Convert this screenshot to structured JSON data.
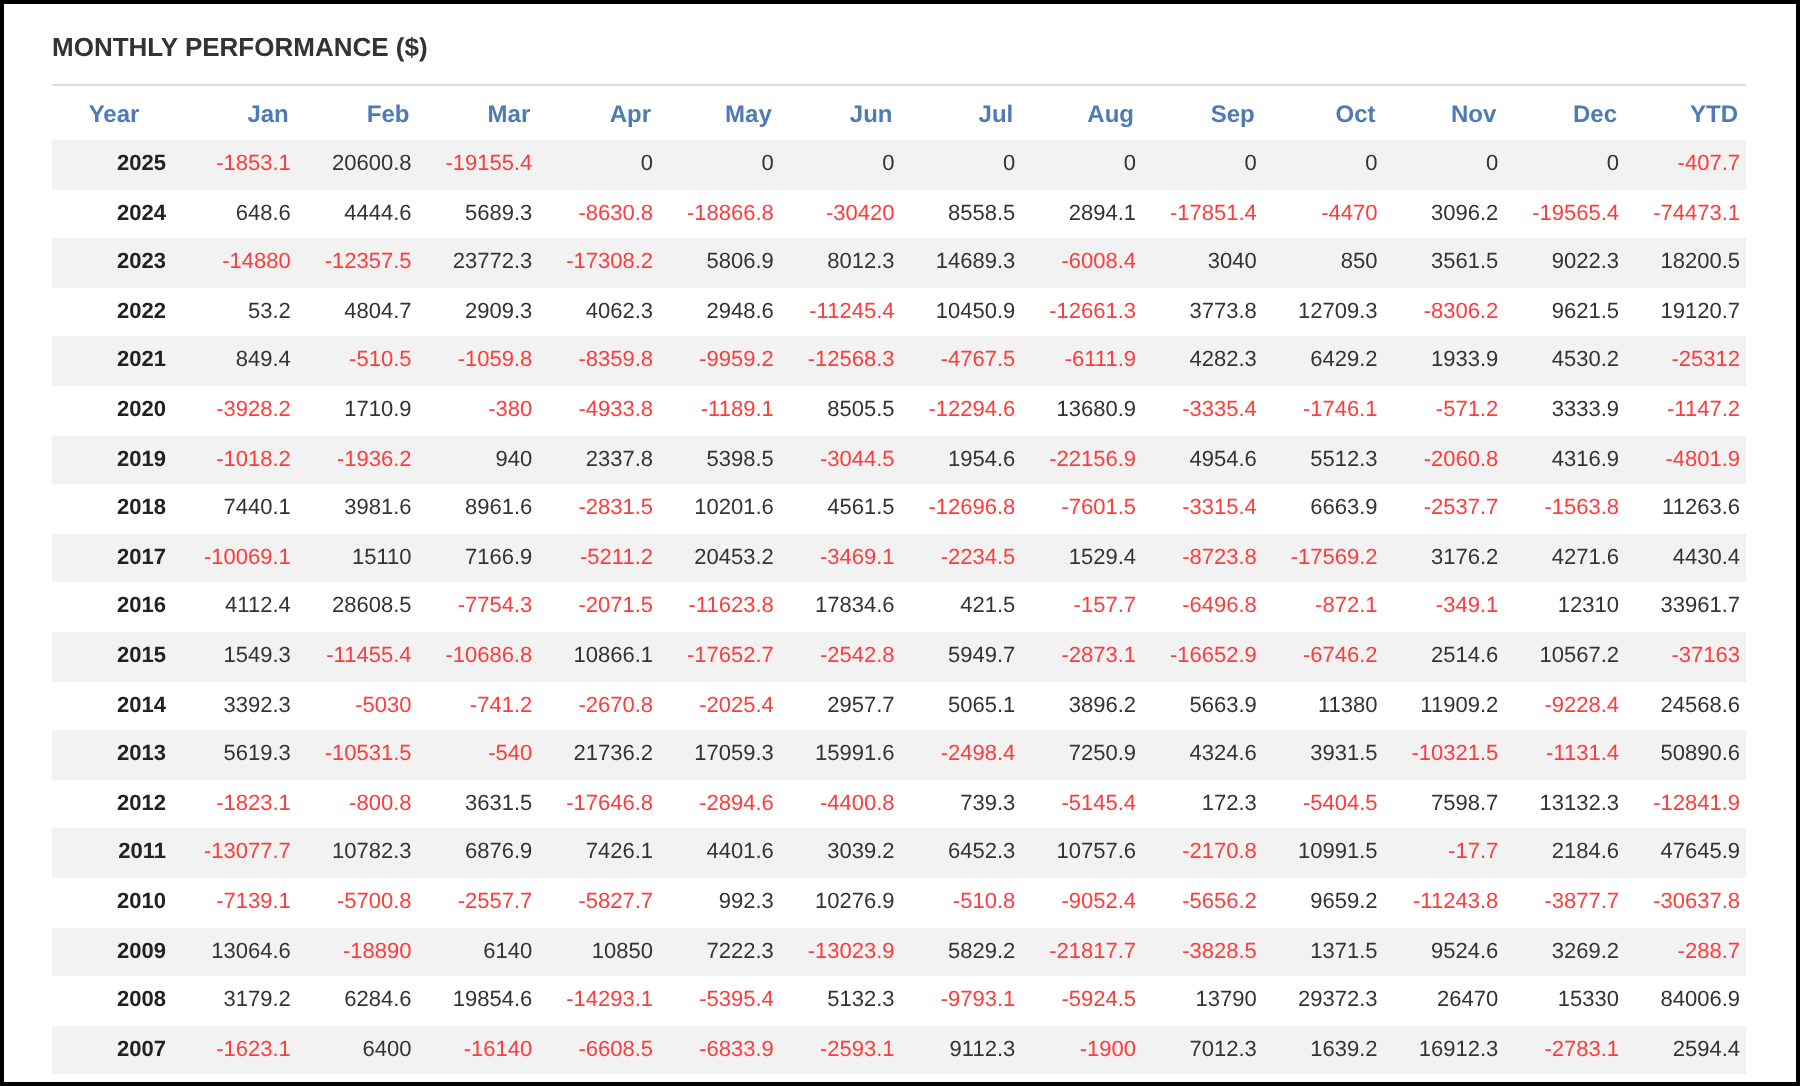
{
  "title": "MONTHLY PERFORMANCE ($)",
  "table": {
    "year_column": "Year",
    "columns": [
      "Jan",
      "Feb",
      "Mar",
      "Apr",
      "May",
      "Jun",
      "Jul",
      "Aug",
      "Sep",
      "Oct",
      "Nov",
      "Dec",
      "YTD"
    ],
    "rows": [
      {
        "year": "2025",
        "cells": [
          {
            "v": "-1853.1",
            "neg": true
          },
          {
            "v": "20600.8",
            "neg": false
          },
          {
            "v": "-19155.4",
            "neg": true
          },
          {
            "v": "0",
            "neg": false
          },
          {
            "v": "0",
            "neg": false
          },
          {
            "v": "0",
            "neg": false
          },
          {
            "v": "0",
            "neg": false
          },
          {
            "v": "0",
            "neg": false
          },
          {
            "v": "0",
            "neg": false
          },
          {
            "v": "0",
            "neg": false
          },
          {
            "v": "0",
            "neg": false
          },
          {
            "v": "0",
            "neg": false
          },
          {
            "v": "-407.7",
            "neg": true
          }
        ]
      },
      {
        "year": "2024",
        "cells": [
          {
            "v": "648.6",
            "neg": false
          },
          {
            "v": "4444.6",
            "neg": false
          },
          {
            "v": "5689.3",
            "neg": false
          },
          {
            "v": "-8630.8",
            "neg": true
          },
          {
            "v": "-18866.8",
            "neg": true
          },
          {
            "v": "-30420",
            "neg": true
          },
          {
            "v": "8558.5",
            "neg": false
          },
          {
            "v": "2894.1",
            "neg": false
          },
          {
            "v": "-17851.4",
            "neg": true
          },
          {
            "v": "-4470",
            "neg": true
          },
          {
            "v": "3096.2",
            "neg": false
          },
          {
            "v": "-19565.4",
            "neg": true
          },
          {
            "v": "-74473.1",
            "neg": true
          }
        ]
      },
      {
        "year": "2023",
        "cells": [
          {
            "v": "-14880",
            "neg": true
          },
          {
            "v": "-12357.5",
            "neg": true
          },
          {
            "v": "23772.3",
            "neg": false
          },
          {
            "v": "-17308.2",
            "neg": true
          },
          {
            "v": "5806.9",
            "neg": false
          },
          {
            "v": "8012.3",
            "neg": false
          },
          {
            "v": "14689.3",
            "neg": false
          },
          {
            "v": "-6008.4",
            "neg": true
          },
          {
            "v": "3040",
            "neg": false
          },
          {
            "v": "850",
            "neg": false
          },
          {
            "v": "3561.5",
            "neg": false
          },
          {
            "v": "9022.3",
            "neg": false
          },
          {
            "v": "18200.5",
            "neg": false
          }
        ]
      },
      {
        "year": "2022",
        "cells": [
          {
            "v": "53.2",
            "neg": false
          },
          {
            "v": "4804.7",
            "neg": false
          },
          {
            "v": "2909.3",
            "neg": false
          },
          {
            "v": "4062.3",
            "neg": false
          },
          {
            "v": "2948.6",
            "neg": false
          },
          {
            "v": "-11245.4",
            "neg": true
          },
          {
            "v": "10450.9",
            "neg": false
          },
          {
            "v": "-12661.3",
            "neg": true
          },
          {
            "v": "3773.8",
            "neg": false
          },
          {
            "v": "12709.3",
            "neg": false
          },
          {
            "v": "-8306.2",
            "neg": true
          },
          {
            "v": "9621.5",
            "neg": false
          },
          {
            "v": "19120.7",
            "neg": false
          }
        ]
      },
      {
        "year": "2021",
        "cells": [
          {
            "v": "849.4",
            "neg": false
          },
          {
            "v": "-510.5",
            "neg": true
          },
          {
            "v": "-1059.8",
            "neg": true
          },
          {
            "v": "-8359.8",
            "neg": true
          },
          {
            "v": "-9959.2",
            "neg": true
          },
          {
            "v": "-12568.3",
            "neg": true
          },
          {
            "v": "-4767.5",
            "neg": true
          },
          {
            "v": "-6111.9",
            "neg": true
          },
          {
            "v": "4282.3",
            "neg": false
          },
          {
            "v": "6429.2",
            "neg": false
          },
          {
            "v": "1933.9",
            "neg": false
          },
          {
            "v": "4530.2",
            "neg": false
          },
          {
            "v": "-25312",
            "neg": true
          }
        ]
      },
      {
        "year": "2020",
        "cells": [
          {
            "v": "-3928.2",
            "neg": true
          },
          {
            "v": "1710.9",
            "neg": false
          },
          {
            "v": "-380",
            "neg": true
          },
          {
            "v": "-4933.8",
            "neg": true
          },
          {
            "v": "-1189.1",
            "neg": true
          },
          {
            "v": "8505.5",
            "neg": false
          },
          {
            "v": "-12294.6",
            "neg": true
          },
          {
            "v": "13680.9",
            "neg": false
          },
          {
            "v": "-3335.4",
            "neg": true
          },
          {
            "v": "-1746.1",
            "neg": true
          },
          {
            "v": "-571.2",
            "neg": true
          },
          {
            "v": "3333.9",
            "neg": false
          },
          {
            "v": "-1147.2",
            "neg": true
          }
        ]
      },
      {
        "year": "2019",
        "cells": [
          {
            "v": "-1018.2",
            "neg": true
          },
          {
            "v": "-1936.2",
            "neg": true
          },
          {
            "v": "940",
            "neg": false
          },
          {
            "v": "2337.8",
            "neg": false
          },
          {
            "v": "5398.5",
            "neg": false
          },
          {
            "v": "-3044.5",
            "neg": true
          },
          {
            "v": "1954.6",
            "neg": false
          },
          {
            "v": "-22156.9",
            "neg": true
          },
          {
            "v": "4954.6",
            "neg": false
          },
          {
            "v": "5512.3",
            "neg": false
          },
          {
            "v": "-2060.8",
            "neg": true
          },
          {
            "v": "4316.9",
            "neg": false
          },
          {
            "v": "-4801.9",
            "neg": true
          }
        ]
      },
      {
        "year": "2018",
        "cells": [
          {
            "v": "7440.1",
            "neg": false
          },
          {
            "v": "3981.6",
            "neg": false
          },
          {
            "v": "8961.6",
            "neg": false
          },
          {
            "v": "-2831.5",
            "neg": true
          },
          {
            "v": "10201.6",
            "neg": false
          },
          {
            "v": "4561.5",
            "neg": false
          },
          {
            "v": "-12696.8",
            "neg": true
          },
          {
            "v": "-7601.5",
            "neg": true
          },
          {
            "v": "-3315.4",
            "neg": true
          },
          {
            "v": "6663.9",
            "neg": false
          },
          {
            "v": "-2537.7",
            "neg": true
          },
          {
            "v": "-1563.8",
            "neg": true
          },
          {
            "v": "11263.6",
            "neg": false
          }
        ]
      },
      {
        "year": "2017",
        "cells": [
          {
            "v": "-10069.1",
            "neg": true
          },
          {
            "v": "15110",
            "neg": false
          },
          {
            "v": "7166.9",
            "neg": false
          },
          {
            "v": "-5211.2",
            "neg": true
          },
          {
            "v": "20453.2",
            "neg": false
          },
          {
            "v": "-3469.1",
            "neg": true
          },
          {
            "v": "-2234.5",
            "neg": true
          },
          {
            "v": "1529.4",
            "neg": false
          },
          {
            "v": "-8723.8",
            "neg": true
          },
          {
            "v": "-17569.2",
            "neg": true
          },
          {
            "v": "3176.2",
            "neg": false
          },
          {
            "v": "4271.6",
            "neg": false
          },
          {
            "v": "4430.4",
            "neg": false
          }
        ]
      },
      {
        "year": "2016",
        "cells": [
          {
            "v": "4112.4",
            "neg": false
          },
          {
            "v": "28608.5",
            "neg": false
          },
          {
            "v": "-7754.3",
            "neg": true
          },
          {
            "v": "-2071.5",
            "neg": true
          },
          {
            "v": "-11623.8",
            "neg": true
          },
          {
            "v": "17834.6",
            "neg": false
          },
          {
            "v": "421.5",
            "neg": false
          },
          {
            "v": "-157.7",
            "neg": true
          },
          {
            "v": "-6496.8",
            "neg": true
          },
          {
            "v": "-872.1",
            "neg": true
          },
          {
            "v": "-349.1",
            "neg": true
          },
          {
            "v": "12310",
            "neg": false
          },
          {
            "v": "33961.7",
            "neg": false
          }
        ]
      },
      {
        "year": "2015",
        "cells": [
          {
            "v": "1549.3",
            "neg": false
          },
          {
            "v": "-11455.4",
            "neg": true
          },
          {
            "v": "-10686.8",
            "neg": true
          },
          {
            "v": "10866.1",
            "neg": false
          },
          {
            "v": "-17652.7",
            "neg": true
          },
          {
            "v": "-2542.8",
            "neg": true
          },
          {
            "v": "5949.7",
            "neg": false
          },
          {
            "v": "-2873.1",
            "neg": true
          },
          {
            "v": "-16652.9",
            "neg": true
          },
          {
            "v": "-6746.2",
            "neg": true
          },
          {
            "v": "2514.6",
            "neg": false
          },
          {
            "v": "10567.2",
            "neg": false
          },
          {
            "v": "-37163",
            "neg": true
          }
        ]
      },
      {
        "year": "2014",
        "cells": [
          {
            "v": "3392.3",
            "neg": false
          },
          {
            "v": "-5030",
            "neg": true
          },
          {
            "v": "-741.2",
            "neg": true
          },
          {
            "v": "-2670.8",
            "neg": true
          },
          {
            "v": "-2025.4",
            "neg": true
          },
          {
            "v": "2957.7",
            "neg": false
          },
          {
            "v": "5065.1",
            "neg": false
          },
          {
            "v": "3896.2",
            "neg": false
          },
          {
            "v": "5663.9",
            "neg": false
          },
          {
            "v": "11380",
            "neg": false
          },
          {
            "v": "11909.2",
            "neg": false
          },
          {
            "v": "-9228.4",
            "neg": true
          },
          {
            "v": "24568.6",
            "neg": false
          }
        ]
      },
      {
        "year": "2013",
        "cells": [
          {
            "v": "5619.3",
            "neg": false
          },
          {
            "v": "-10531.5",
            "neg": true
          },
          {
            "v": "-540",
            "neg": true
          },
          {
            "v": "21736.2",
            "neg": false
          },
          {
            "v": "17059.3",
            "neg": false
          },
          {
            "v": "15991.6",
            "neg": false
          },
          {
            "v": "-2498.4",
            "neg": true
          },
          {
            "v": "7250.9",
            "neg": false
          },
          {
            "v": "4324.6",
            "neg": false
          },
          {
            "v": "3931.5",
            "neg": false
          },
          {
            "v": "-10321.5",
            "neg": true
          },
          {
            "v": "-1131.4",
            "neg": true
          },
          {
            "v": "50890.6",
            "neg": false
          }
        ]
      },
      {
        "year": "2012",
        "cells": [
          {
            "v": "-1823.1",
            "neg": true
          },
          {
            "v": "-800.8",
            "neg": true
          },
          {
            "v": "3631.5",
            "neg": false
          },
          {
            "v": "-17646.8",
            "neg": true
          },
          {
            "v": "-2894.6",
            "neg": true
          },
          {
            "v": "-4400.8",
            "neg": true
          },
          {
            "v": "739.3",
            "neg": false
          },
          {
            "v": "-5145.4",
            "neg": true
          },
          {
            "v": "172.3",
            "neg": false
          },
          {
            "v": "-5404.5",
            "neg": true
          },
          {
            "v": "7598.7",
            "neg": false
          },
          {
            "v": "13132.3",
            "neg": false
          },
          {
            "v": "-12841.9",
            "neg": true
          }
        ]
      },
      {
        "year": "2011",
        "cells": [
          {
            "v": "-13077.7",
            "neg": true
          },
          {
            "v": "10782.3",
            "neg": false
          },
          {
            "v": "6876.9",
            "neg": false
          },
          {
            "v": "7426.1",
            "neg": false
          },
          {
            "v": "4401.6",
            "neg": false
          },
          {
            "v": "3039.2",
            "neg": false
          },
          {
            "v": "6452.3",
            "neg": false
          },
          {
            "v": "10757.6",
            "neg": false
          },
          {
            "v": "-2170.8",
            "neg": true
          },
          {
            "v": "10991.5",
            "neg": false
          },
          {
            "v": "-17.7",
            "neg": true
          },
          {
            "v": "2184.6",
            "neg": false
          },
          {
            "v": "47645.9",
            "neg": false
          }
        ]
      },
      {
        "year": "2010",
        "cells": [
          {
            "v": "-7139.1",
            "neg": true
          },
          {
            "v": "-5700.8",
            "neg": true
          },
          {
            "v": "-2557.7",
            "neg": true
          },
          {
            "v": "-5827.7",
            "neg": true
          },
          {
            "v": "992.3",
            "neg": false
          },
          {
            "v": "10276.9",
            "neg": false
          },
          {
            "v": "-510.8",
            "neg": true
          },
          {
            "v": "-9052.4",
            "neg": true
          },
          {
            "v": "-5656.2",
            "neg": true
          },
          {
            "v": "9659.2",
            "neg": false
          },
          {
            "v": "-11243.8",
            "neg": true
          },
          {
            "v": "-3877.7",
            "neg": true
          },
          {
            "v": "-30637.8",
            "neg": true
          }
        ]
      },
      {
        "year": "2009",
        "cells": [
          {
            "v": "13064.6",
            "neg": false
          },
          {
            "v": "-18890",
            "neg": true
          },
          {
            "v": "6140",
            "neg": false
          },
          {
            "v": "10850",
            "neg": false
          },
          {
            "v": "7222.3",
            "neg": false
          },
          {
            "v": "-13023.9",
            "neg": true
          },
          {
            "v": "5829.2",
            "neg": false
          },
          {
            "v": "-21817.7",
            "neg": true
          },
          {
            "v": "-3828.5",
            "neg": true
          },
          {
            "v": "1371.5",
            "neg": false
          },
          {
            "v": "9524.6",
            "neg": false
          },
          {
            "v": "3269.2",
            "neg": false
          },
          {
            "v": "-288.7",
            "neg": true
          }
        ]
      },
      {
        "year": "2008",
        "cells": [
          {
            "v": "3179.2",
            "neg": false
          },
          {
            "v": "6284.6",
            "neg": false
          },
          {
            "v": "19854.6",
            "neg": false
          },
          {
            "v": "-14293.1",
            "neg": true
          },
          {
            "v": "-5395.4",
            "neg": true
          },
          {
            "v": "5132.3",
            "neg": false
          },
          {
            "v": "-9793.1",
            "neg": true
          },
          {
            "v": "-5924.5",
            "neg": true
          },
          {
            "v": "13790",
            "neg": false
          },
          {
            "v": "29372.3",
            "neg": false
          },
          {
            "v": "26470",
            "neg": false
          },
          {
            "v": "15330",
            "neg": false
          },
          {
            "v": "84006.9",
            "neg": false
          }
        ]
      },
      {
        "year": "2007",
        "cells": [
          {
            "v": "-1623.1",
            "neg": true
          },
          {
            "v": "6400",
            "neg": false
          },
          {
            "v": "-16140",
            "neg": true
          },
          {
            "v": "-6608.5",
            "neg": true
          },
          {
            "v": "-6833.9",
            "neg": true
          },
          {
            "v": "-2593.1",
            "neg": true
          },
          {
            "v": "9112.3",
            "neg": false
          },
          {
            "v": "-1900",
            "neg": true
          },
          {
            "v": "7012.3",
            "neg": false
          },
          {
            "v": "1639.2",
            "neg": false
          },
          {
            "v": "16912.3",
            "neg": false
          },
          {
            "v": "-2783.1",
            "neg": true
          },
          {
            "v": "2594.4",
            "neg": false
          }
        ]
      }
    ]
  }
}
